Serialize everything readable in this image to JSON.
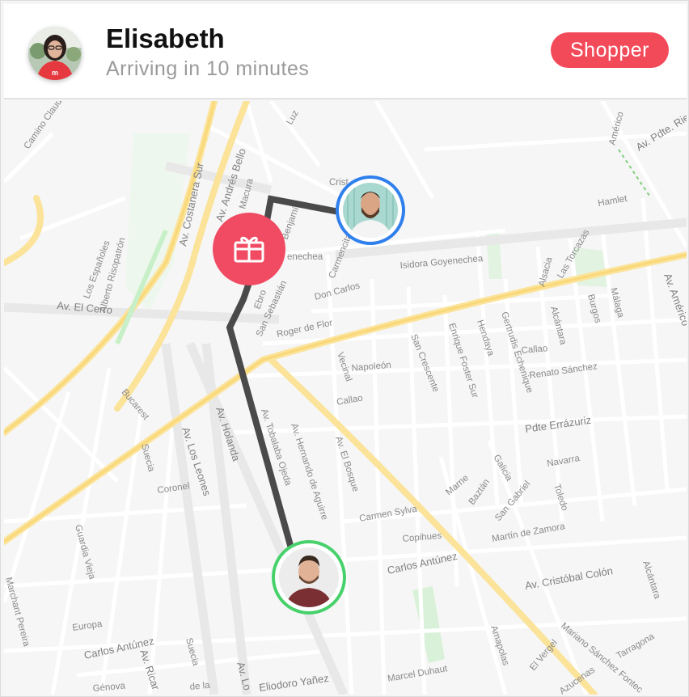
{
  "header": {
    "driver_name": "Elisabeth",
    "eta": "Arriving in 10 minutes",
    "role_badge": "Shopper"
  },
  "colors": {
    "badge": "#f34a5a",
    "route": "#4a4a4a",
    "shopper_ring": "#2f80ed",
    "customer_ring": "#47d16b",
    "gift_marker": "#f04b63",
    "major_road": "#fbe39a"
  },
  "map": {
    "streets": {
      "camino_claudio": "Camino Claudio",
      "av_costanera_sur": "Av. Costanera Sur",
      "av_andres_bello": "Av. Andrés Bello",
      "av_pdte_riesco": "Av. Pdte. Ries",
      "americo": "Américo",
      "luz": "Luz",
      "cristal": "Crist",
      "macura": "Macura",
      "benjamin": "Benjamín",
      "hamlet": "Hamlet",
      "las_torcazas": "Las Torcazas",
      "los_espanoles": "Los Españoles",
      "alberto_risopatron": "Alberto Risopatrón",
      "av_el_cerro": "Av. El Cerro",
      "isidora_goyenechea_left": "enechea",
      "isidora_goyenechea": "Isidora Goyenechea",
      "alsacia": "Alsacia",
      "av_americo": "Av. Américo",
      "carmencita": "Carmencita",
      "don_carlos": "Don Carlos",
      "ebro": "Ebro",
      "san_sebastian": "San Sebastián",
      "roger_de_flor": "Roger de Flor",
      "alcantara": "Alcántara",
      "burgos": "Burgos",
      "malaga": "Málaga",
      "callao_1": "Callao",
      "callao_2": "Callao",
      "gertrudis_echenique": "Gertrudis Echenique",
      "hendaya": "Hendaya",
      "enrique_foster_sur": "Enrique Foster Sur",
      "san_crescente": "San Crescente",
      "vecinal": "Vecinal",
      "napoleon": "Napoleón",
      "renato_sanchez": "Renato Sánchez",
      "bucarest": "Bucarest",
      "av_holanda": "Av. Holanda",
      "av_los_leones": "Av. Los Leones",
      "av_hernando_de_aguirre": "Av. Hernando de Aguirre",
      "av_el_bosque": "Av. El Bosque",
      "pdte_errazuriz": "Pdte Errázuriz",
      "suecia": "Suecia",
      "coronel": "Coronel",
      "av_tobalaba": "Av. Tobalaba Ojeda",
      "marne": "Marne",
      "baztan": "Baztán",
      "galicia": "Galicia",
      "san_gabriel": "San Gabriel",
      "navarra": "Navarra",
      "toledo": "Toledo",
      "guardia_vieja": "Guardia Vieja",
      "carmen_sylva": "Carmen Sylva",
      "copihues": "Copihues",
      "martin_de_zamora": "Martín de Zamora",
      "carlos_antunez": "Carlos Antúnez",
      "av_cristobal_colon": "Av. Cristóbal Colón",
      "alcantara_2": "Alcántara",
      "marchant_pereira": "Marchant Pereira",
      "europa": "Europa",
      "carlos_antunez_2": "Carlos Antúnez",
      "av_ricardo": "Av. Ricar",
      "suecia_2": "Suecia",
      "av_lo": "Av. Lo",
      "eliodoro_yanez": "Eliodoro Yañez",
      "amapolas": "Amapolas",
      "el_vergel": "El Vergel",
      "mariano_sanchez_fontecilla": "Mariano Sánchez Fontec",
      "tarragona": "Tarragona",
      "marcel_duhaut": "Marcel Duhaut",
      "azucenas": "Azucenas",
      "genova": "Génova",
      "de_la": "de la"
    }
  },
  "markers": {
    "shopper": "shopper-avatar",
    "pickup": "gift-icon",
    "customer": "customer-avatar"
  }
}
